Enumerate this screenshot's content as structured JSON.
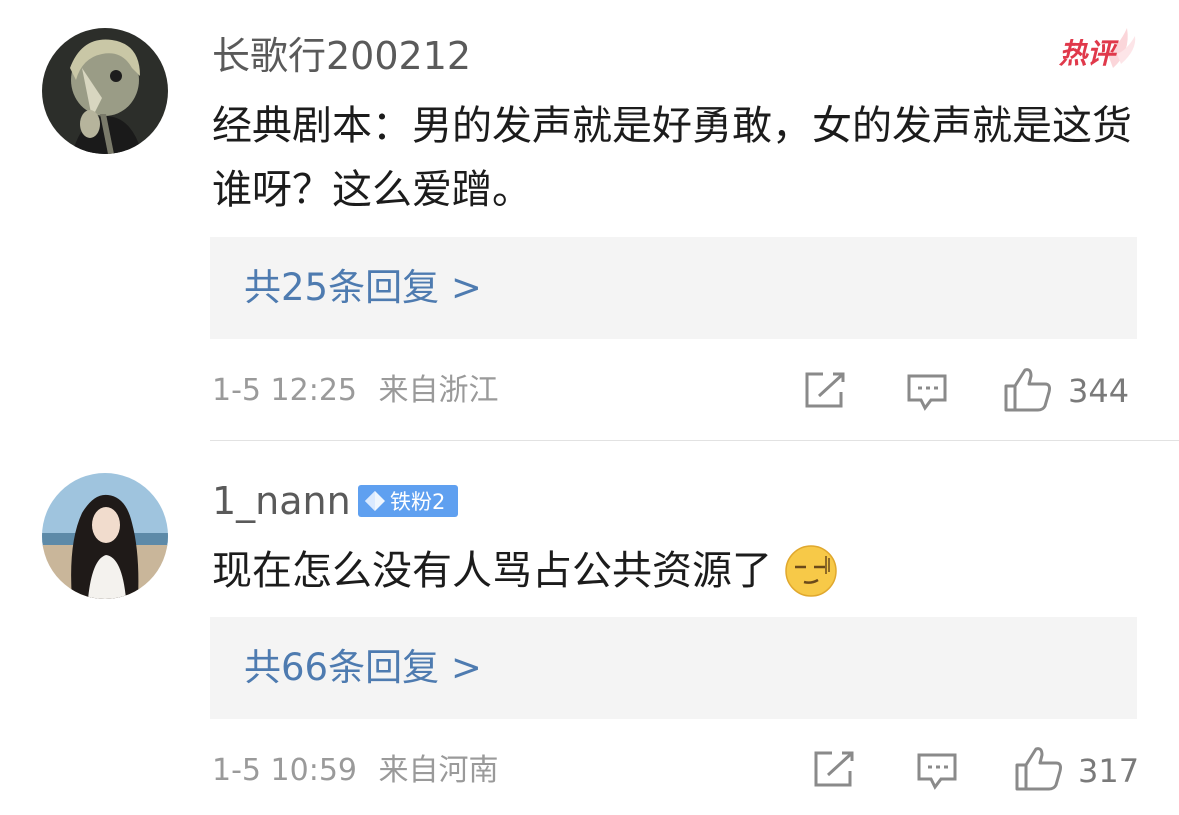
{
  "comments": [
    {
      "username": "长歌行200212",
      "hot_label": "热评",
      "content": "经典剧本：男的发声就是好勇敢，女的发声就是这货谁呀？这么爱蹭。",
      "replies": "共25条回复 >",
      "time": "1-5 12:25",
      "location": "来自浙江",
      "likes": "344"
    },
    {
      "username": "1_nann",
      "badge": "铁粉2",
      "content": "现在怎么没有人骂占公共资源了",
      "emoji": "awkward-smile-emoji",
      "replies": "共66条回复 >",
      "time": "1-5 10:59",
      "location": "来自河南",
      "likes": "317"
    }
  ],
  "colors": {
    "reply_link": "#4e7bb0",
    "badge": "#5fa0f0",
    "hot_label": "#e0394b"
  }
}
